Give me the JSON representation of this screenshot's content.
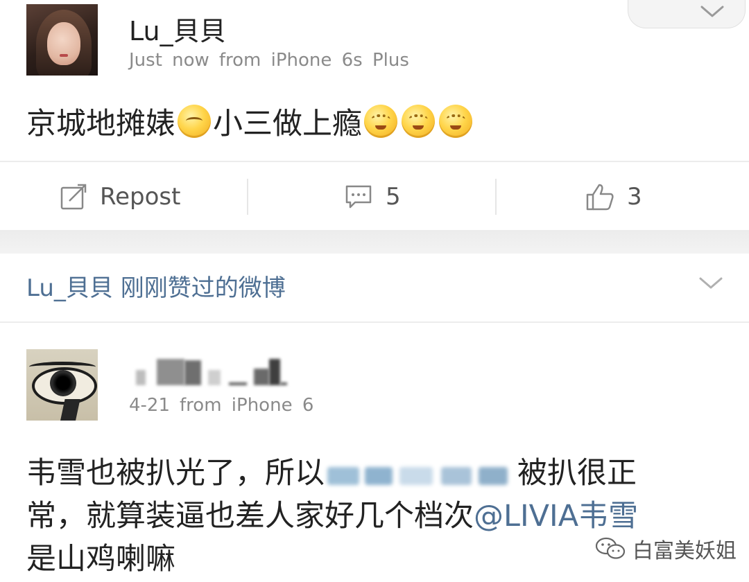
{
  "post1": {
    "username": "Lu_貝貝",
    "time": "Just now",
    "from_label": "from",
    "device": "iPhone 6s Plus",
    "text_a": "京城地摊婊",
    "text_b": "小三做上瘾",
    "actions": {
      "repost_label": "Repost",
      "comment_count": "5",
      "like_count": "3"
    }
  },
  "liked_header": {
    "user": "Lu_貝貝",
    "label": "刚刚赞过的微博"
  },
  "post2": {
    "time": "4-21",
    "from_label": "from",
    "device": "iPhone 6",
    "line1_a": "韦雪也被扒光了，所以",
    "line1_b": "被扒很正",
    "line2_a": "常，就算装逼也差人家好几个档次",
    "mention": "@LIVIA韦雪",
    "line3": "是山鸡喇嘛"
  },
  "watermark": {
    "text": "白富美妖姐"
  },
  "icons": [
    "repost-icon",
    "comment-icon",
    "like-icon",
    "chevron-down-icon",
    "wechat-icon"
  ],
  "colors": {
    "link": "#4e6f93",
    "meta": "#8a8a8a",
    "band": "#ececec"
  }
}
